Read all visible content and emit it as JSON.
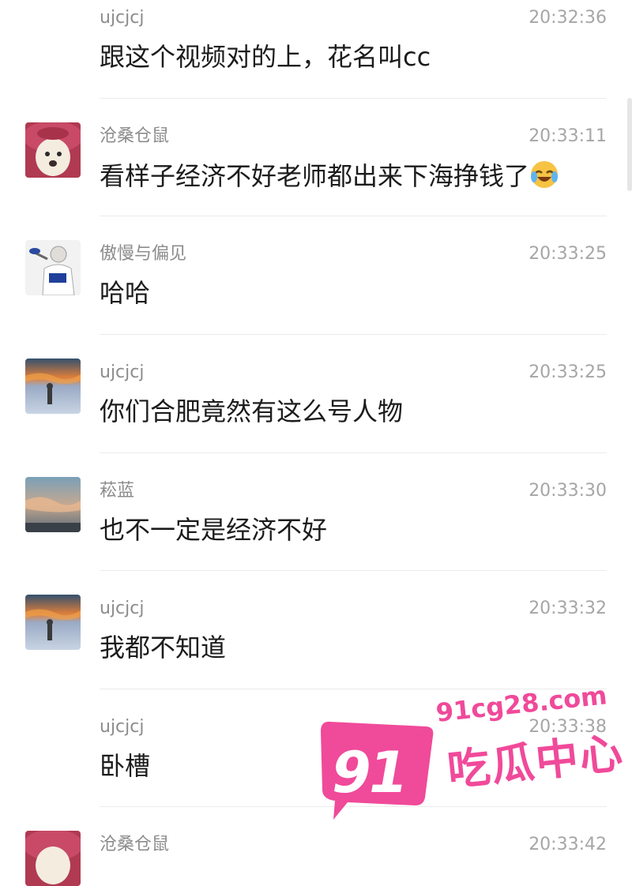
{
  "messages": [
    {
      "name": "ujcjcj",
      "time": "20:32:36",
      "text": "跟这个视频对的上，花名叫cc",
      "avatar": "none"
    },
    {
      "name": "沧桑仓鼠",
      "time": "20:33:11",
      "text": "看样子经济不好老师都出来下海挣钱了",
      "avatar": "dog-avatar",
      "emoji": "laughing-crying-emoji"
    },
    {
      "name": "傲慢与偏见",
      "time": "20:33:25",
      "text": "哈哈",
      "avatar": "sketch-person-avatar"
    },
    {
      "name": "ujcjcj",
      "time": "20:33:25",
      "text": "你们合肥竟然有这么号人物",
      "avatar": "sunset-person-avatar"
    },
    {
      "name": "菘蓝",
      "time": "20:33:30",
      "text": "也不一定是经济不好",
      "avatar": "sky-clouds-avatar"
    },
    {
      "name": "ujcjcj",
      "time": "20:33:32",
      "text": "我都不知道",
      "avatar": "sunset-person-avatar"
    },
    {
      "name": "ujcjcj",
      "time": "20:33:38",
      "text": "卧槽",
      "avatar": "none"
    },
    {
      "name": "沧桑仓鼠",
      "time": "20:33:42",
      "text": "",
      "avatar": "dog-avatar"
    }
  ],
  "watermark": {
    "number": "91",
    "url": "91cg28.com",
    "title": "吃瓜中心",
    "color": "#f04a9a"
  }
}
